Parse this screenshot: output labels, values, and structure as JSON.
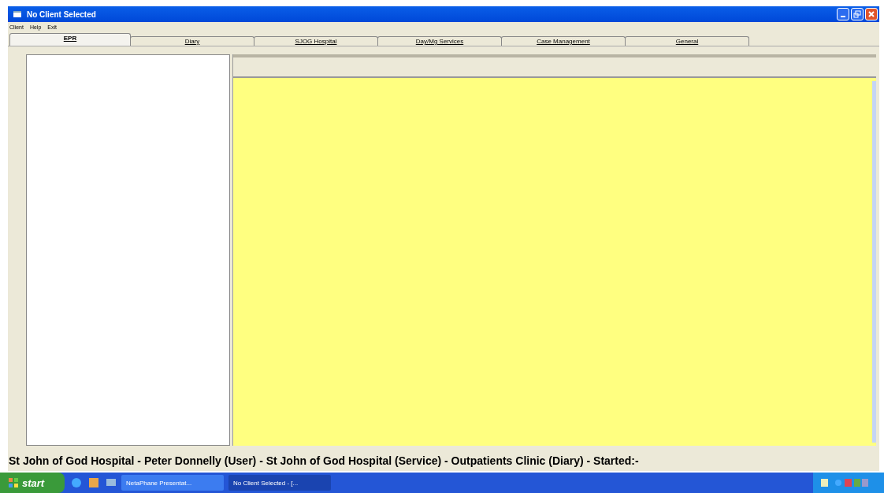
{
  "window": {
    "title": "No Client Selected"
  },
  "menu": [
    "Client",
    "Help",
    "Exit"
  ],
  "tabs": [
    {
      "label": "EPR",
      "selected": true
    },
    {
      "label": "Diary",
      "selected": false
    },
    {
      "label": "SJOG Hospital",
      "selected": false
    },
    {
      "label": "Day/Mg Services",
      "selected": false
    },
    {
      "label": "Case Management",
      "selected": false
    },
    {
      "label": "General",
      "selected": false
    }
  ],
  "status_bar": "St John of God Hospital - Peter Donnelly (User)  - St John of God Hospital (Service) - Outpatients Clinic (Diary) -  Started:-",
  "taskbar": {
    "start": "start",
    "tasks": [
      {
        "label": "NetaPhane Presentat...",
        "selected": false
      },
      {
        "label": "No Client Selected - [...",
        "selected": true
      }
    ]
  }
}
